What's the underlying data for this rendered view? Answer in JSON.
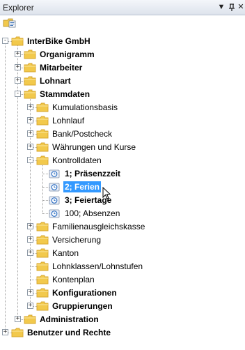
{
  "panel": {
    "title": "Explorer"
  },
  "titlebar": {
    "dropdown_glyph": "▼",
    "pin_glyph": "ꟸ",
    "close_glyph": "✕"
  },
  "toolbar": {
    "icon": "folder-properties-icon"
  },
  "colors": {
    "folder": "#f2c94c",
    "folder_dark": "#d7a52a",
    "selection": "#3399ff",
    "clock": "#2f6fc2"
  },
  "tree": {
    "root": "InterBike GmbH",
    "items": [
      {
        "label": "Organigramm"
      },
      {
        "label": "Mitarbeiter"
      },
      {
        "label": "Lohnart"
      },
      {
        "label": "Stammdaten"
      },
      {
        "label": "Kumulationsbasis"
      },
      {
        "label": "Lohnlauf"
      },
      {
        "label": "Bank/Postcheck"
      },
      {
        "label": "Währungen und Kurse"
      },
      {
        "label": "Kontrolldaten"
      },
      {
        "label": "1; Präsenzzeit"
      },
      {
        "label": "2; Ferien"
      },
      {
        "label": "3; Feiertage"
      },
      {
        "label": "100; Absenzen"
      },
      {
        "label": "Familienausgleichskasse"
      },
      {
        "label": "Versicherung"
      },
      {
        "label": "Kanton"
      },
      {
        "label": "Lohnklassen/Lohnstufen"
      },
      {
        "label": "Kontenplan"
      },
      {
        "label": "Konfigurationen"
      },
      {
        "label": "Gruppierungen"
      },
      {
        "label": "Administration"
      },
      {
        "label": "Benutzer und Rechte"
      }
    ]
  }
}
